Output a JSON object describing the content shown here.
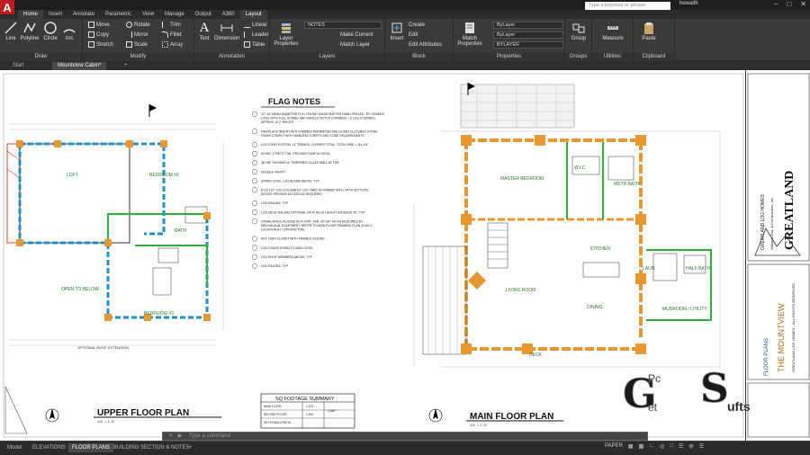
{
  "app": {
    "logo_letter": "A",
    "search_placeholder": "Type a keyword or phrase",
    "user": "hewaith",
    "tabs": [
      "Home",
      "Insert",
      "Annotate",
      "Parametric",
      "View",
      "Manage",
      "Output",
      "A360",
      "Layout"
    ]
  },
  "ribbon": {
    "draw": {
      "label": "Draw",
      "line": "Line",
      "polyline": "Polyline",
      "circle": "Circle",
      "arc": "Arc"
    },
    "modify": {
      "label": "Modify",
      "move": "Move",
      "rotate": "Rotate",
      "trim": "Trim",
      "copy": "Copy",
      "mirror": "Mirror",
      "fillet": "Fillet",
      "stretch": "Stretch",
      "scale": "Scale",
      "array": "Array"
    },
    "annotation": {
      "label": "Annotation",
      "text": "Text",
      "dimension": "Dimension",
      "linear": "Linear",
      "leader": "Leader",
      "table": "Table"
    },
    "layers": {
      "label": "Layers",
      "layer_properties": "Layer Properties",
      "layer_dropdown": "NOTES",
      "make_current": "Make Current",
      "match_layer": "Match Layer"
    },
    "block": {
      "label": "Block",
      "insert": "Insert",
      "create": "Create",
      "edit": "Edit",
      "edit_attributes": "Edit Attributes"
    },
    "properties": {
      "label": "Properties",
      "match_properties": "Match Properties",
      "bylayer_1": "ByLayer",
      "bylayer_2": "ByLayer",
      "bylayer_3": "BYLAYER"
    },
    "groups": {
      "label": "Groups",
      "group": "Group"
    },
    "utilities": {
      "label": "Utilities",
      "measure": "Measure"
    },
    "clipboard": {
      "label": "Clipboard",
      "paste": "Paste"
    }
  },
  "doc_tabs": [
    "Start",
    "Mountview Cabin*"
  ],
  "drawing": {
    "flag_notes_title": "FLAG NOTES",
    "notes": [
      "12\"-14\" MEAN DIAMETER FULL ROUND HANDCRAFTED HAND-PEELED, TPI GRADED LOGS WITH FULL SCRIBE AND SADDLE NOTCH CORNERS = 8 LOG COURSES, APPROX. 8'-0\" HEIGHT",
      "FIREPLACE INSERT WITH FRAMED PERIMETER WALLS AND CULTURED STONE FINISH COMPLY WITH MANUFACTURER'S AND CODE REQUIREMENTS",
      "LOG STAIR SYSTEM, 11\" TREADS, 15 RISES TOTAL, TOTAL RISE = 114-3/4\"",
      "60\"x60\" 2-PIECE TUB. PROVIDE PUMP ACCESS.",
      "36\"x36\" SHOWER w/ TEMPERED GLASS WALL AT TUB",
      "DOUBLE VANITY",
      "UPPER LEVEL LOG BEAMS ABOVE, TYP.",
      "8-1/2\"x10\" LOG COLUMN BY LOG YARD IN FRAMED WALL WITH SETTLING DEVICE PROVIDE ACCESS AS REQUIRED.",
      "LOG RAILING: TYP",
      "LOG DECK RAILING OPTIONAL OR IF DECK HEIGHT EXCEEDS 30\", TYP",
      "CRAWLSPACE ACCESS IN FLOOR - MIN. 30\"x30\" OR AS REQUIRED BY MECHANICAL EQUIPMENT. REFER TO MAIN FLOOR FRAMING PLAN (EXACT LOCATION BY CONTRACTOR)",
      "W-0\" HIGH CLOSET WITH FRAMED CEILING",
      "LOG STAIRS DOWN TO MAIN LEVEL",
      "LOG ROOF MEMBERS ABOVE, TYP",
      "LOG RAILING: TYP"
    ],
    "upper_plan_title": "UPPER FLOOR PLAN",
    "upper_plan_scale": "1/4\" = 1'-0\"",
    "main_plan_title": "MAIN FLOOR PLAN",
    "main_plan_scale": "1/4\" = 1'-0\"",
    "sq_footage": {
      "title": "SQ FOOTAGE SUMMARY",
      "rows": [
        {
          "label": "MAIN FLOOR",
          "value": "1,123"
        },
        {
          "label": "SECOND FLOOR",
          "value": "1,165"
        },
        {
          "label": "DECKS/BALC/PATIO",
          "value": ""
        }
      ],
      "total": "2,288"
    },
    "upper_rooms": [
      "LOFT",
      "BEDROOM #2",
      "BATH",
      "OPEN TO BELOW",
      "BEDROOM #3"
    ],
    "main_rooms": [
      "MASTER BEDROOM",
      "W.I.C.",
      "MSTR BATH",
      "LIVING ROOM",
      "KITCHEN",
      "DINING",
      "HALF BATH",
      "MUDROOM / UTILITY",
      "DECK",
      "LAUN."
    ],
    "roof_ext_note": "OPTIONAL ROOF EXTENSION"
  },
  "title_block": {
    "company": "GREATLAND LOG HOMES",
    "brand": "GREATLAND",
    "company_detail": "Williams Ent. & Construction, Inc.",
    "project": "THE MOUNTVIEW",
    "sheet": "FLOOR PLANS",
    "rights": "GREATLAND LOG HOMES - ALL RIGHTS RESERVED"
  },
  "command_line": {
    "placeholder": "Type a command"
  },
  "layout_tabs": [
    "Model",
    "ELEVATIONS",
    "FLOOR PLANS",
    "BUILDING SECTION & NOTES"
  ],
  "status": {
    "paper": "PAPER"
  },
  "watermark": {
    "g": "G",
    "pc": "Pc",
    "et": "et",
    "s": "S",
    "ufts": "ufts"
  }
}
